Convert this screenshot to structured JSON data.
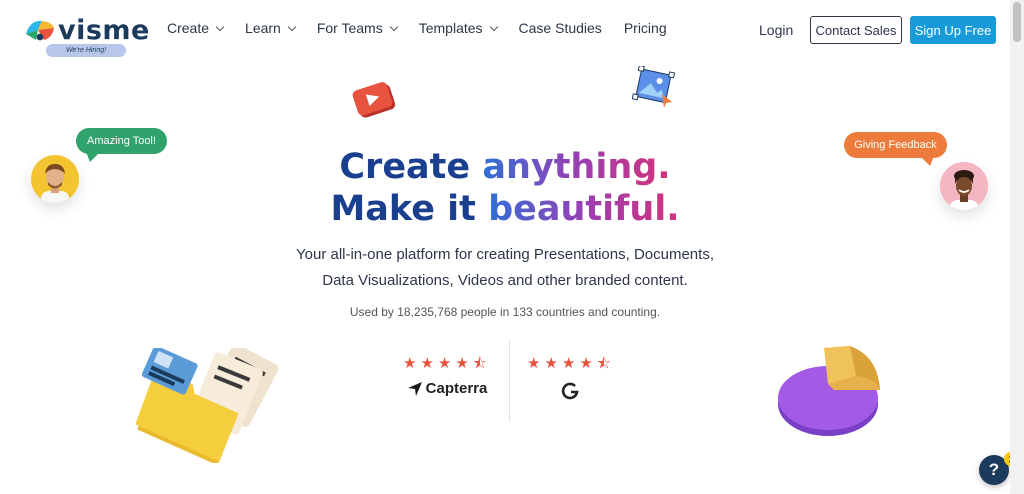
{
  "header": {
    "logo_text": "visme",
    "hiring_badge": "We're Hiring!",
    "nav": [
      {
        "label": "Create",
        "dropdown": true
      },
      {
        "label": "Learn",
        "dropdown": true
      },
      {
        "label": "For Teams",
        "dropdown": true
      },
      {
        "label": "Templates",
        "dropdown": true
      },
      {
        "label": "Case Studies",
        "dropdown": false
      },
      {
        "label": "Pricing",
        "dropdown": false
      }
    ],
    "login": "Login",
    "contact_sales": "Contact Sales",
    "signup": "Sign Up Free"
  },
  "hero": {
    "line1_a": "Create ",
    "line1_b": "anything.",
    "line2_a": "Make it ",
    "line2_b": "beautiful.",
    "subtitle_line1": "Your all-in-one platform for creating Presentations, Documents,",
    "subtitle_line2": "Data Visualizations, Videos and other branded content.",
    "usage": "Used by 18,235,768 people in 133 countries and counting."
  },
  "bubbles": {
    "left": "Amazing Tool!",
    "right": "Giving Feedback"
  },
  "ratings": [
    {
      "stars": "★★★★⯪",
      "brand": "Capterra",
      "value": 4.5
    },
    {
      "stars": "★★★★⯪",
      "brand": "G2",
      "value": 4.5
    }
  ],
  "help": {
    "label": "?",
    "badge": "1"
  },
  "colors": {
    "brand_blue": "#179ad7",
    "navy": "#1b3a5c",
    "star": "#e8533d",
    "bubble_green": "#2fa36b",
    "bubble_orange": "#ec7b3c"
  }
}
